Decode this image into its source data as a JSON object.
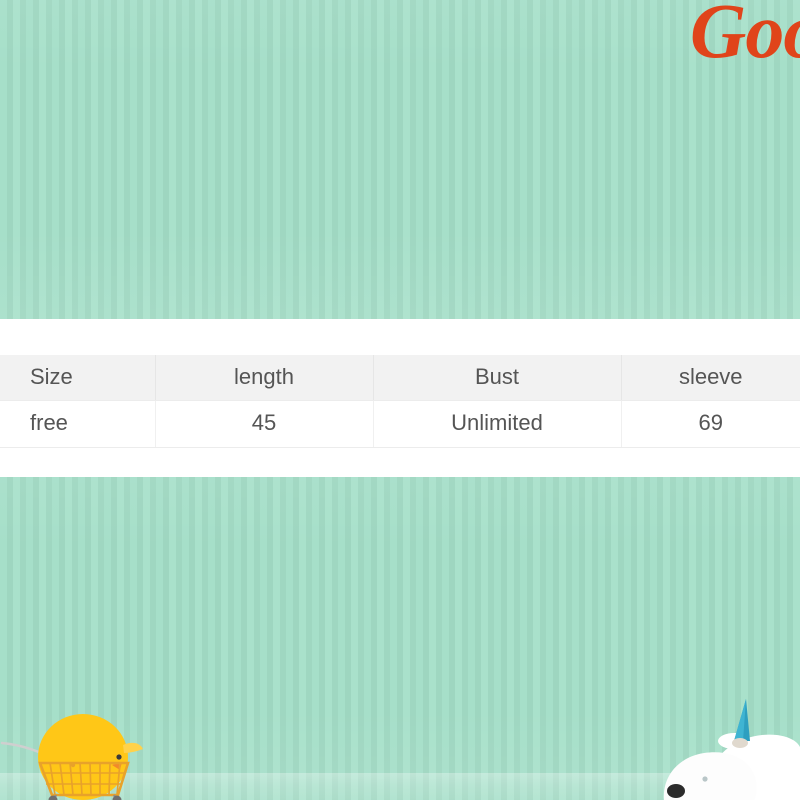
{
  "brand": {
    "script_text": "Good"
  },
  "product_images": {
    "top": {
      "alt": "striped mint green backdrop with brand script",
      "background_color": "#a3dcc6",
      "stripe_light": "#a9e1cb",
      "stripe_dark": "#9ed6c0",
      "brand_color": "#e0441a"
    },
    "bottom": {
      "alt": "striped mint green backdrop with chick in shopping cart and polar bear wearing a party hat",
      "background_color": "#a3dcc6",
      "chick_color": "#ffc717",
      "cart_color": "#e8a22a",
      "bear_color": "#ffffff",
      "hat_color": "#2e9fc0"
    }
  },
  "size_table": {
    "columns": [
      "Size",
      "length",
      "Bust",
      "sleeve"
    ],
    "rows": [
      [
        "free",
        "45",
        "Unlimited",
        "69"
      ]
    ],
    "header_background": "#f2f2f2",
    "text_color": "#555555"
  }
}
